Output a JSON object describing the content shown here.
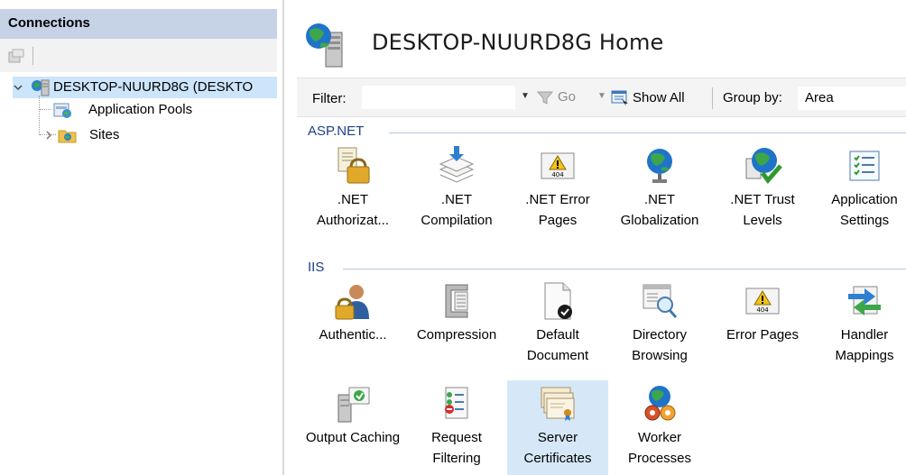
{
  "connections": {
    "header": "Connections",
    "tree": {
      "server": "DESKTOP-NUURD8G (DESKTO",
      "children": [
        {
          "label": "Application Pools"
        },
        {
          "label": "Sites"
        }
      ]
    }
  },
  "main": {
    "title": "DESKTOP-NUURD8G Home",
    "filter_bar": {
      "filter_label": "Filter:",
      "filter_value": "",
      "go_label": "Go",
      "show_all_label": "Show All",
      "group_by_label": "Group by:",
      "group_by_value": "Area"
    },
    "groups": [
      {
        "name": "ASP.NET",
        "features": [
          {
            "label": ".NET Authorizat...",
            "icon": "lock-document-icon"
          },
          {
            "label": ".NET Compilation",
            "icon": "stack-download-icon"
          },
          {
            "label": ".NET Error Pages",
            "icon": "warning-404-icon"
          },
          {
            "label": ".NET Globalization",
            "icon": "globe-icon"
          },
          {
            "label": ".NET Trust Levels",
            "icon": "globe-check-icon"
          },
          {
            "label": "Application Settings",
            "icon": "settings-list-icon"
          }
        ]
      },
      {
        "name": "IIS",
        "features": [
          {
            "label": "Authentic...",
            "icon": "user-lock-icon"
          },
          {
            "label": "Compression",
            "icon": "clamp-icon"
          },
          {
            "label": "Default Document",
            "icon": "document-check-icon"
          },
          {
            "label": "Directory Browsing",
            "icon": "magnifier-window-icon"
          },
          {
            "label": "Error Pages",
            "icon": "warning-404-icon"
          },
          {
            "label": "Handler Mappings",
            "icon": "arrows-icon"
          },
          {
            "label": "Output Caching",
            "icon": "server-cache-icon"
          },
          {
            "label": "Request Filtering",
            "icon": "filter-list-icon"
          },
          {
            "label": "Server Certificates",
            "icon": "certificate-icon"
          },
          {
            "label": "Worker Processes",
            "icon": "globe-gears-icon"
          }
        ]
      }
    ]
  },
  "colors": {
    "header_bg": "#c6d3e6",
    "selection_bg": "#cce5fb",
    "group_text": "#1e3f8a",
    "selected_tile_bg": "#d6e8f8"
  }
}
